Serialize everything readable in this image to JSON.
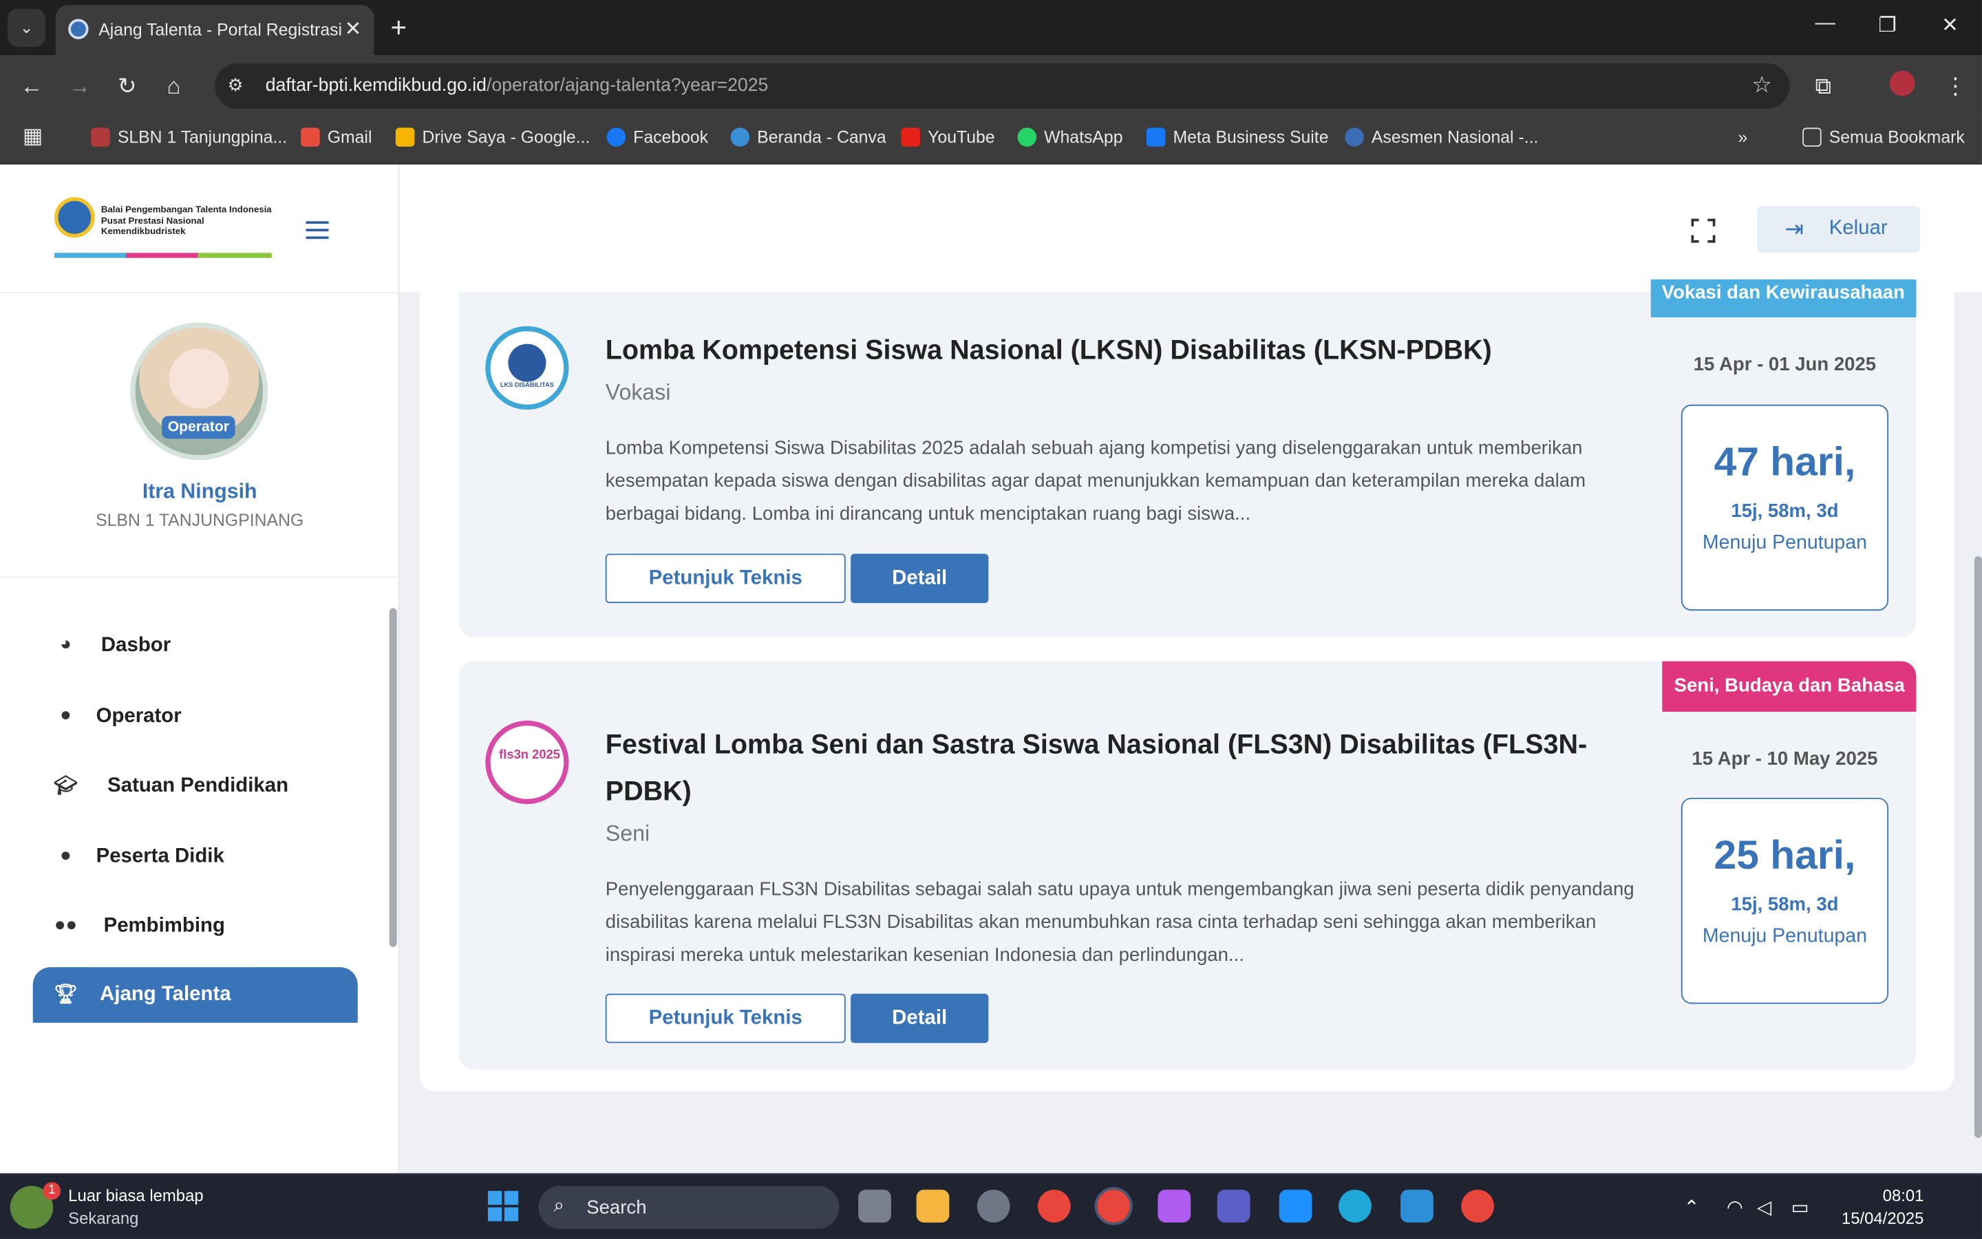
{
  "browser": {
    "tab_title": "Ajang Talenta - Portal Registrasi",
    "url_host": "daftar-bpti.kemdikbud.go.id",
    "url_path": "/operator/ajang-talenta?year=2025",
    "bookmarks": [
      "SLBN 1 Tanjungpina...",
      "Gmail",
      "Drive Saya - Google...",
      "Facebook",
      "Beranda - Canva",
      "YouTube",
      "WhatsApp",
      "Meta Business Suite",
      "Asesmen Nasional -..."
    ],
    "all_bookmarks_label": "Semua Bookmark"
  },
  "app": {
    "logo_text": "Balai Pengembangan Talenta Indonesia\nPusat Prestasi Nasional\nKemendikbudristek",
    "logout_label": "Keluar"
  },
  "profile": {
    "role_badge": "Operator",
    "name": "Itra Ningsih",
    "school": "SLBN 1 TANJUNGPINANG"
  },
  "sidebar": {
    "items": [
      {
        "label": "Dasbor",
        "icon": "palette-icon"
      },
      {
        "label": "Operator",
        "icon": "user-icon"
      },
      {
        "label": "Satuan Pendidikan",
        "icon": "graduation-cap-icon"
      },
      {
        "label": "Peserta Didik",
        "icon": "user-icon"
      },
      {
        "label": "Pembimbing",
        "icon": "users-icon"
      },
      {
        "label": "Ajang Talenta",
        "icon": "trophy-icon",
        "active": true
      }
    ]
  },
  "events": [
    {
      "category": "Vokasi dan Kewirausahaan",
      "category_color": "#4aaee0",
      "title": "Lomba Kompetensi Siswa Nasional (LKSN) Disabilitas (LKSN-PDBK)",
      "subtitle": "Vokasi",
      "description": "Lomba Kompetensi Siswa Disabilitas 2025 adalah sebuah ajang kompetisi yang diselenggarakan untuk memberikan kesempatan kepada siswa dengan disabilitas agar dapat menunjukkan kemampuan dan keterampilan mereka dalam berbagai bidang. Lomba ini dirancang untuk menciptakan ruang bagi siswa...",
      "date_range": "15 Apr - 01 Jun 2025",
      "countdown_days": "47 hari,",
      "countdown_time": "15j, 58m, 3d",
      "countdown_label": "Menuju Penutupan",
      "btn_guide": "Petunjuk Teknis",
      "btn_detail": "Detail",
      "logo_label": "LKS DISABILITAS"
    },
    {
      "category": "Seni, Budaya dan Bahasa",
      "category_color": "#e0357f",
      "title": "Festival Lomba Seni dan Sastra Siswa Nasional (FLS3N) Disabilitas (FLS3N-PDBK)",
      "subtitle": "Seni",
      "description": "Penyelenggaraan FLS3N Disabilitas sebagai salah satu upaya untuk mengembangkan jiwa seni peserta didik penyandang disabilitas karena melalui FLS3N Disabilitas akan menumbuhkan rasa cinta terhadap seni sehingga akan memberikan inspirasi mereka untuk melestarikan kesenian Indonesia dan perlindungan...",
      "date_range": "15 Apr - 10 May 2025",
      "countdown_days": "25 hari,",
      "countdown_time": "15j, 58m, 3d",
      "countdown_label": "Menuju Penutupan",
      "btn_guide": "Petunjuk Teknis",
      "btn_detail": "Detail",
      "logo_label": "fls3n 2025"
    }
  ],
  "taskbar": {
    "weather_title": "Luar biasa lembap",
    "weather_sub": "Sekarang",
    "notif_count": "1",
    "search_label": "Search",
    "time": "08:01",
    "date": "15/04/2025"
  }
}
